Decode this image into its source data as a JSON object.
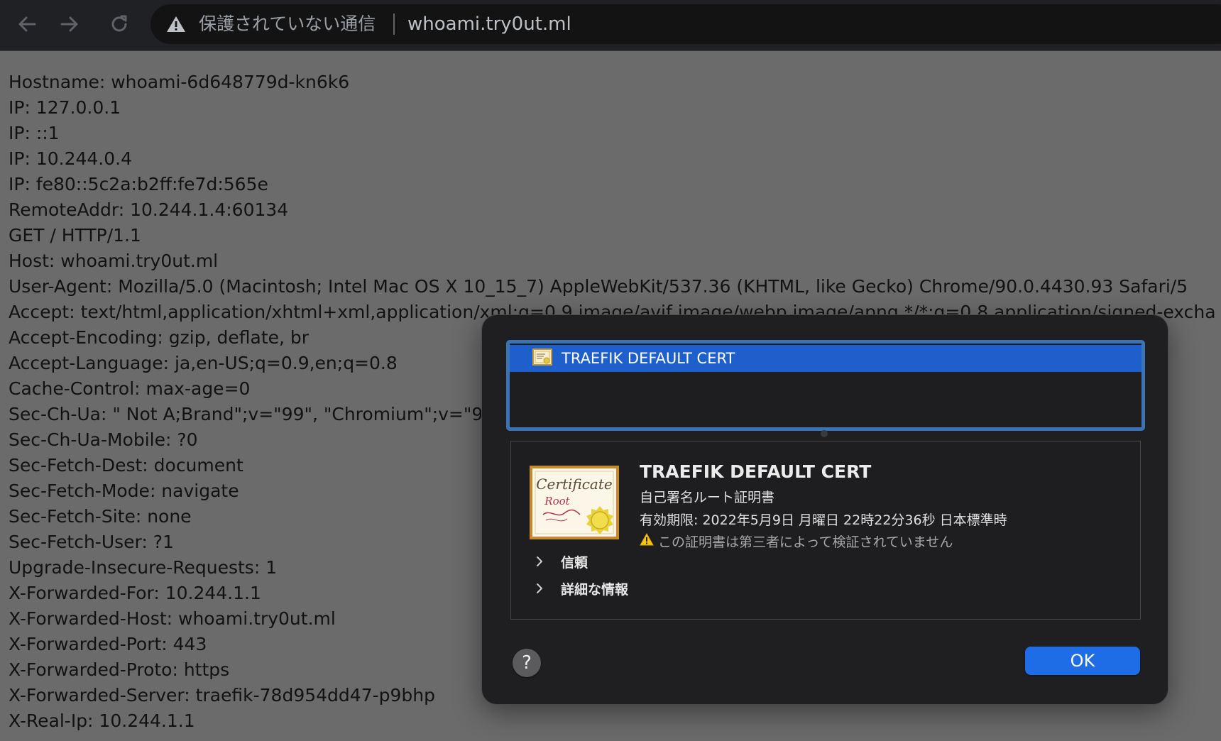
{
  "browser": {
    "back_icon": "arrow-left-icon",
    "forward_icon": "arrow-right-icon",
    "reload_icon": "reload-icon",
    "security_icon": "warning-triangle-icon",
    "security_status": "保護されていない通信",
    "url": "whoami.try0ut.ml"
  },
  "page": {
    "lines": [
      "Hostname: whoami-6d648779d-kn6k6",
      "IP: 127.0.0.1",
      "IP: ::1",
      "IP: 10.244.0.4",
      "IP: fe80::5c2a:b2ff:fe7d:565e",
      "RemoteAddr: 10.244.1.4:60134",
      "GET / HTTP/1.1",
      "Host: whoami.try0ut.ml",
      "User-Agent: Mozilla/5.0 (Macintosh; Intel Mac OS X 10_15_7) AppleWebKit/537.36 (KHTML, like Gecko) Chrome/90.0.4430.93 Safari/5",
      "Accept: text/html,application/xhtml+xml,application/xml;q=0.9,image/avif,image/webp,image/apng,*/*;q=0.8,application/signed-excha",
      "Accept-Encoding: gzip, deflate, br",
      "Accept-Language: ja,en-US;q=0.9,en;q=0.8",
      "Cache-Control: max-age=0",
      "Sec-Ch-Ua: \" Not A;Brand\";v=\"99\", \"Chromium\";v=\"9",
      "Sec-Ch-Ua-Mobile: ?0",
      "Sec-Fetch-Dest: document",
      "Sec-Fetch-Mode: navigate",
      "Sec-Fetch-Site: none",
      "Sec-Fetch-User: ?1",
      "Upgrade-Insecure-Requests: 1",
      "X-Forwarded-For: 10.244.1.1",
      "X-Forwarded-Host: whoami.try0ut.ml",
      "X-Forwarded-Port: 443",
      "X-Forwarded-Proto: https",
      "X-Forwarded-Server: traefik-78d954dd47-p9bhp",
      "X-Real-Ip: 10.244.1.1"
    ]
  },
  "dialog": {
    "cert_list": [
      {
        "label": "TRAEFIK DEFAULT CERT",
        "icon": "certificate-icon",
        "selected": true
      }
    ],
    "details": {
      "image_icon": "certificate-root-icon",
      "image_text_top": "Certificate",
      "image_text_sub": "Root",
      "title": "TRAEFIK DEFAULT CERT",
      "type": "自己署名ルート証明書",
      "expiry": "有効期限: 2022年5月9日 月曜日 22時22分36秒 日本標準時",
      "warning_icon": "warning-triangle-icon",
      "warning": "この証明書は第三者によって検証されていません",
      "sections": [
        {
          "label": "信頼",
          "icon": "chevron-right-icon"
        },
        {
          "label": "詳細な情報",
          "icon": "chevron-right-icon"
        }
      ]
    },
    "help_label": "?",
    "ok_label": "OK"
  },
  "colors": {
    "toolbar_bg": "#202124",
    "page_dim_bg": "#6b6b6b",
    "dialog_bg": "#1f1f21",
    "selection_blue": "#1f5fcc",
    "focus_ring": "#3b74b5",
    "ok_blue": "#1e6de6",
    "warning_yellow": "#f5c518"
  }
}
